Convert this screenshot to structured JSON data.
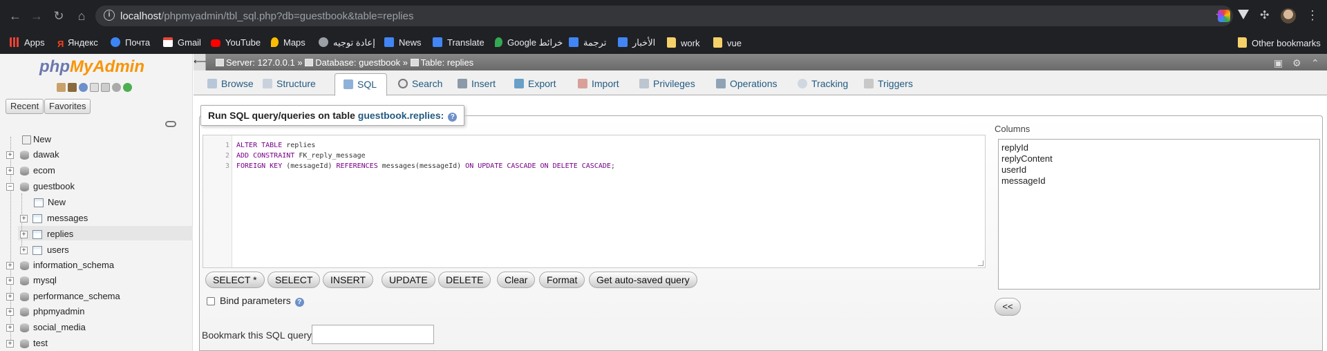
{
  "browser": {
    "url_host": "localhost",
    "url_path": "/phpmyadmin/tbl_sql.php?db=guestbook&table=replies",
    "bookmarks": [
      {
        "label": "Apps",
        "icon": "apps-grid-icon",
        "color": "#4285f4"
      },
      {
        "label": "Яндекс",
        "icon": "yandex-icon",
        "color": "#fc3f1d"
      },
      {
        "label": "Почта",
        "icon": "mail-icon",
        "color": "#3d85f5"
      },
      {
        "label": "Gmail",
        "icon": "gmail-icon",
        "color": "#ea4335"
      },
      {
        "label": "YouTube",
        "icon": "youtube-icon",
        "color": "#ff0000"
      },
      {
        "label": "Maps",
        "icon": "maps-pin-icon",
        "color": "#fbbc04"
      },
      {
        "label": "إعادة توجيه",
        "icon": "redirect-icon",
        "color": "#9aa0a6"
      },
      {
        "label": "News",
        "icon": "news-icon",
        "color": "#4285f4"
      },
      {
        "label": "Translate",
        "icon": "translate-icon",
        "color": "#4285f4"
      },
      {
        "label": "Google خرائط",
        "icon": "maps-pin-icon",
        "color": "#34a853"
      },
      {
        "label": "ترجمة",
        "icon": "translate-icon",
        "color": "#4285f4"
      },
      {
        "label": "الأخبار",
        "icon": "news-icon",
        "color": "#4285f4"
      },
      {
        "label": "work",
        "icon": "folder-icon",
        "color": "#f5d16a"
      },
      {
        "label": "vue",
        "icon": "folder-icon",
        "color": "#f5d16a"
      }
    ],
    "other_bookmarks": "Other bookmarks"
  },
  "nav": {
    "logo_php": "php",
    "logo_my": "MyAdmin",
    "recent": "Recent",
    "favorites": "Favorites",
    "tree": {
      "new": "New",
      "dawak": "dawak",
      "ecom": "ecom",
      "guestbook": "guestbook",
      "gb_new": "New",
      "messages": "messages",
      "replies": "replies",
      "users": "users",
      "information_schema": "information_schema",
      "mysql": "mysql",
      "performance_schema": "performance_schema",
      "phpmyadmin": "phpmyadmin",
      "social_media": "social_media",
      "test": "test"
    }
  },
  "breadcrumb": {
    "server": "Server: 127.0.0.1",
    "database": "Database: guestbook",
    "table": "Table: replies",
    "sep": "»"
  },
  "tabs": {
    "browse": "Browse",
    "structure": "Structure",
    "sql": "SQL",
    "search": "Search",
    "insert": "Insert",
    "export": "Export",
    "import": "Import",
    "privileges": "Privileges",
    "operations": "Operations",
    "tracking": "Tracking",
    "triggers": "Triggers"
  },
  "query": {
    "legend_prefix": "Run SQL query/queries on table",
    "legend_table": "guestbook.replies:",
    "lines": {
      "n1": "1",
      "n2": "2",
      "n3": "3",
      "l1_kw": "ALTER TABLE",
      "l1_rest": " replies",
      "l2_kw": "ADD CONSTRAINT",
      "l2_rest": " FK_reply_message",
      "l3_kw1": "FOREIGN KEY",
      "l3_a": " (messageId) ",
      "l3_kw2": "REFERENCES",
      "l3_b": " messages(messageId) ",
      "l3_kw3": "ON UPDATE CASCADE ON DELETE CASCADE",
      "l3_end": ";"
    },
    "buttons": {
      "select_star": "SELECT *",
      "select": "SELECT",
      "insert": "INSERT",
      "update": "UPDATE",
      "delete": "DELETE",
      "clear": "Clear",
      "format": "Format",
      "autosaved": "Get auto-saved query"
    },
    "bind_params": "Bind parameters",
    "bookmark_label": "Bookmark this SQL query:",
    "bookmark_value": ""
  },
  "columns": {
    "label": "Columns",
    "items": [
      "replyId",
      "replyContent",
      "userId",
      "messageId"
    ],
    "insert_btn": "<<"
  }
}
